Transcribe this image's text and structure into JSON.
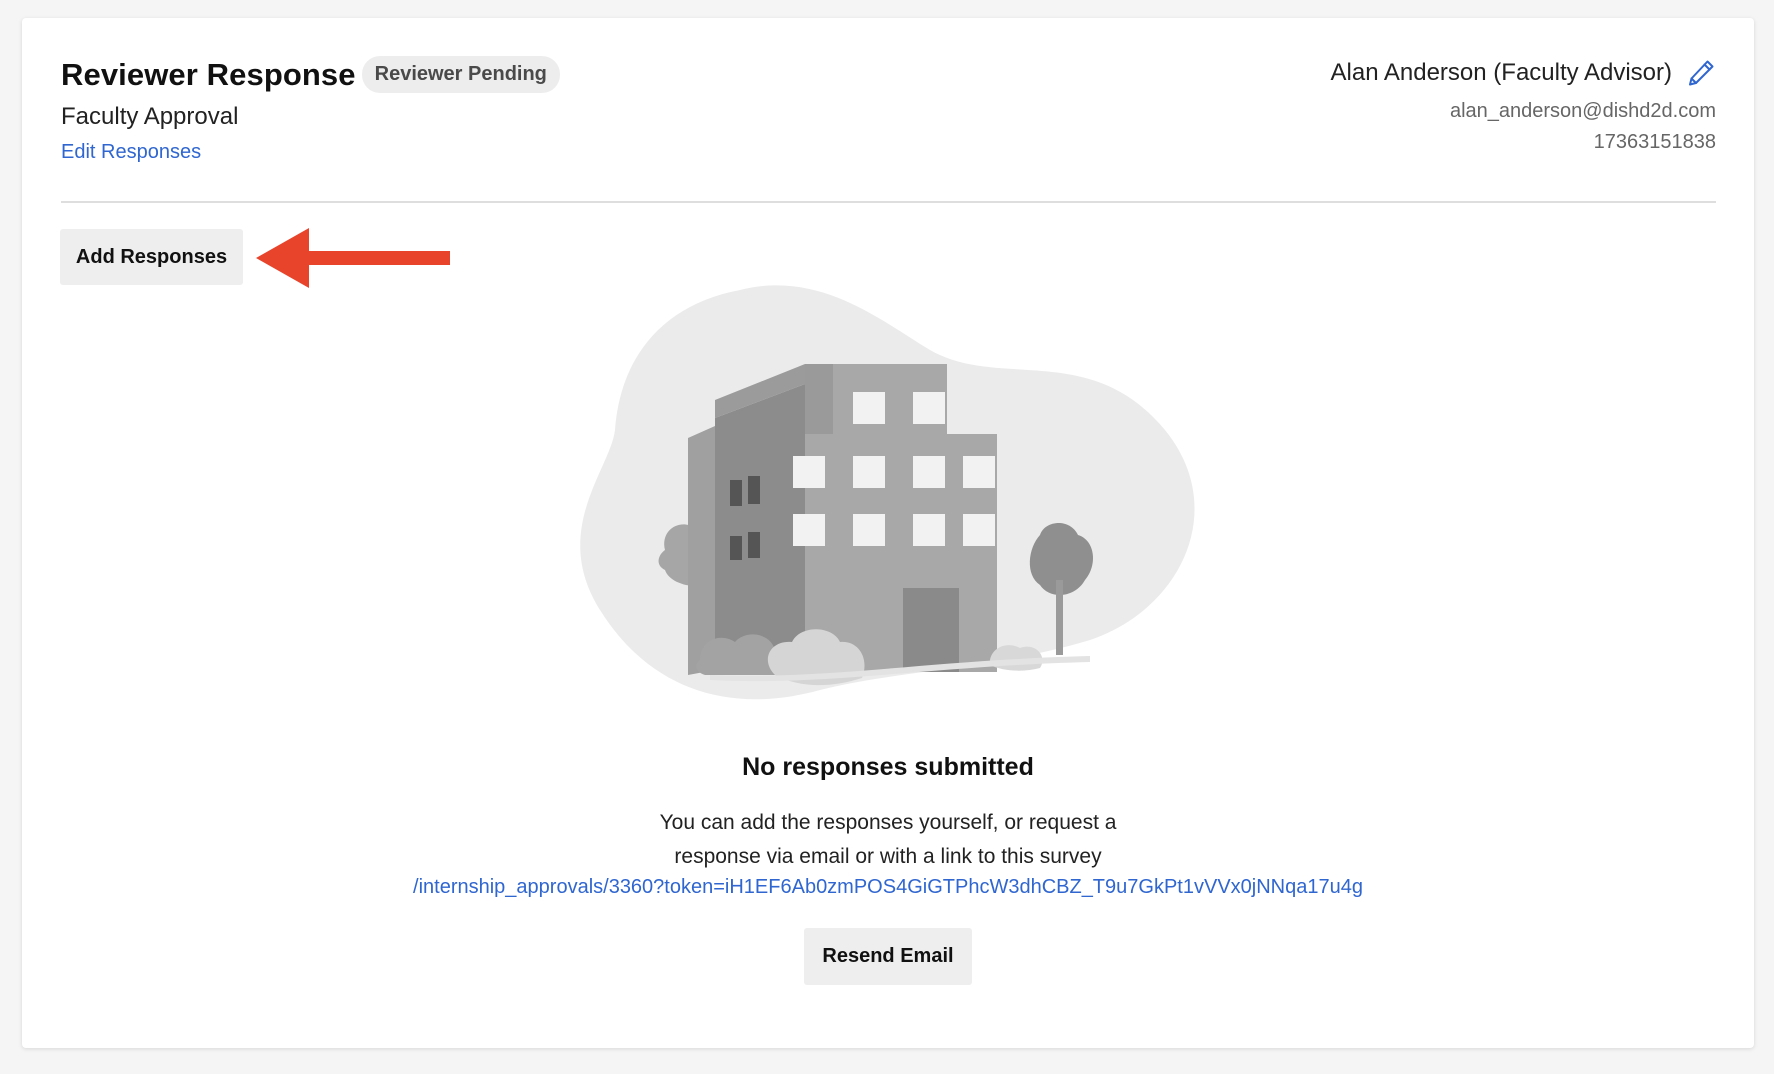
{
  "header": {
    "title": "Reviewer Response",
    "status_badge": "Reviewer Pending",
    "subtitle": "Faculty Approval",
    "edit_link": "Edit Responses"
  },
  "reviewer": {
    "name": "Alan Anderson (Faculty Advisor)",
    "email": "alan_anderson@dishd2d.com",
    "phone": "17363151838",
    "edit_icon": "pencil-icon"
  },
  "actions": {
    "add_responses_label": "Add Responses",
    "resend_email_label": "Resend Email"
  },
  "empty_state": {
    "illustration": "building-illustration",
    "title": "No responses submitted",
    "line1": "You can add the responses yourself, or request a",
    "line2": "response via email or with a link to this survey",
    "link": "/internship_approvals/3360?token=iH1EF6Ab0zmPOS4GiGTPhcW3dhCBZ_T9u7GkPt1vVVx0jNNqa17u4g"
  },
  "annotation": {
    "arrow_icon": "red-arrow-icon"
  },
  "colors": {
    "link": "#2f66d0",
    "badge_bg": "#ededed",
    "button_bg": "#eeeeee",
    "annotation_arrow": "#e8442c"
  }
}
